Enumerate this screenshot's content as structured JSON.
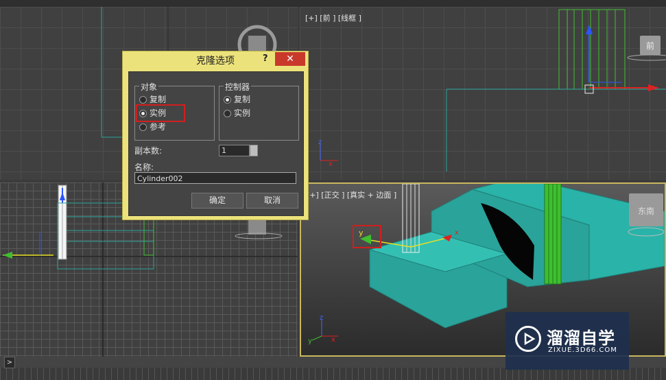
{
  "viewports": {
    "top_left": {
      "label": ""
    },
    "front": {
      "label": "[+] [前 ] [线框 ]",
      "viewcube": "前"
    },
    "left": {
      "label": ""
    },
    "perspective": {
      "label": "[+] [正交 ] [真实 + 边面 ]",
      "viewcube": "东南",
      "gizmo_axis_y": "y",
      "gizmo_axis_x": "x"
    }
  },
  "axis_labels": {
    "z": "z",
    "x": "x",
    "y": "y"
  },
  "dialog": {
    "title": "克隆选项",
    "help": "?",
    "close": "✕",
    "object_group": {
      "title": "对象",
      "options": [
        "复制",
        "实例",
        "参考"
      ],
      "selected": "实例"
    },
    "controller_group": {
      "title": "控制器",
      "options": [
        "复制",
        "实例"
      ],
      "selected": "复制"
    },
    "copies_label": "副本数:",
    "copies_value": "1",
    "name_label": "名称:",
    "name_value": "Cylinder002",
    "ok": "确定",
    "cancel": "取消"
  },
  "timeline": {
    "arrow": ">"
  },
  "watermark": {
    "name": "溜溜自学",
    "url": "ZIXUE.3D66.COM"
  },
  "colors": {
    "highlight": "#d21e1e",
    "dialog_frame": "#ece27b",
    "teal": "#2aa39a",
    "cylinder": "#3fbf2f"
  }
}
